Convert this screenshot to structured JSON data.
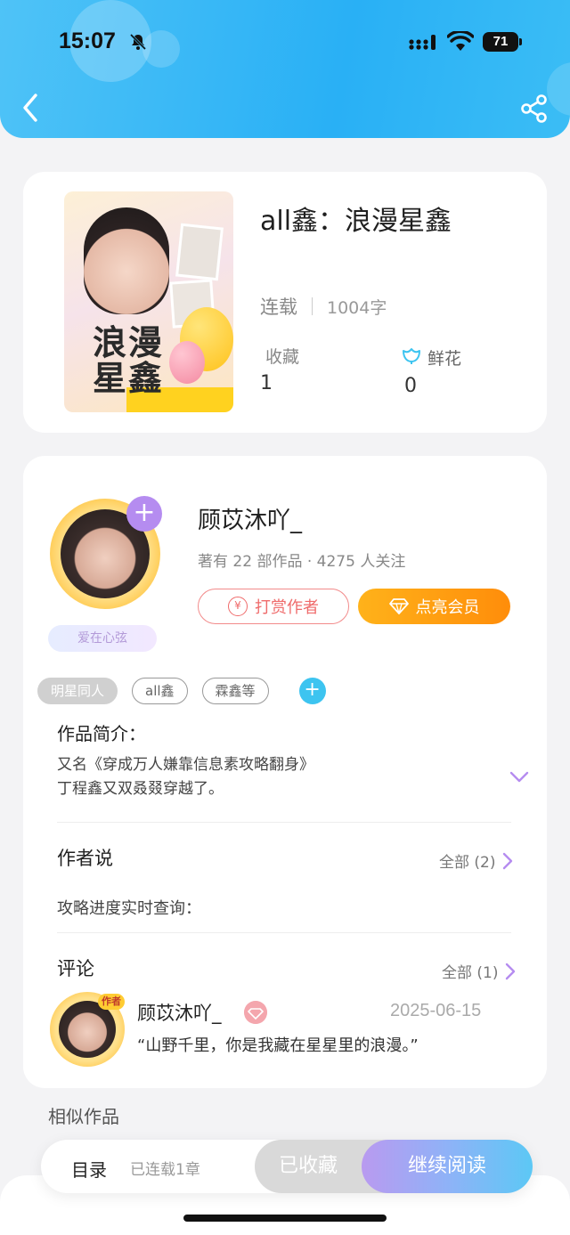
{
  "status_bar": {
    "time": "15:07",
    "battery": "71"
  },
  "book": {
    "title": "all鑫：浪漫星鑫",
    "status": "连载",
    "word_count": "1004字",
    "cover_title": "浪漫星鑫",
    "favorites_label": "收藏",
    "favorites_value": "1",
    "flowers_label": "鲜花",
    "flowers_value": "0"
  },
  "author": {
    "name": "顾苡沐吖_",
    "stats": "著有 22 部作品 · 4275 人关注",
    "badge": "爱在心弦",
    "reward_label": "打赏作者",
    "reward_icon": "¥",
    "vip_label": "点亮会员"
  },
  "tags": [
    "明星同人",
    "all鑫",
    "霖鑫等"
  ],
  "intro": {
    "title": "作品简介：",
    "line1": "又名《穿成万人嫌靠信息素攻略翻身》",
    "line2": "丁程鑫又双叒叕穿越了。"
  },
  "author_says": {
    "title": "作者说",
    "see_all": "全部 (2)",
    "text": "攻略进度实时查询："
  },
  "comments": {
    "title": "评论",
    "see_all": "全部 (1)",
    "items": [
      {
        "user": "顾苡沐吖_",
        "tag": "作者",
        "date": "2025-06-15",
        "text": "“山野千里，你是我藏在星星里的浪漫。”"
      }
    ]
  },
  "similar_title": "相似作品",
  "bottom_bar": {
    "toc_label": "目录",
    "toc_count": "已连载1章",
    "collected_label": "已收藏",
    "continue_label": "继续阅读"
  },
  "colors": {
    "header": "#29b0f5",
    "vip": "#ff8d0a",
    "reward": "#ef6b6b",
    "accent_purple": "#b58cf0"
  },
  "icons": [
    "back-icon",
    "share-icon",
    "bell-off-icon",
    "signal-icon",
    "wifi-icon",
    "flower-icon",
    "plus-icon",
    "coin-icon",
    "diamond-icon",
    "chevron-down-icon",
    "chevron-right-icon",
    "gem-icon"
  ]
}
